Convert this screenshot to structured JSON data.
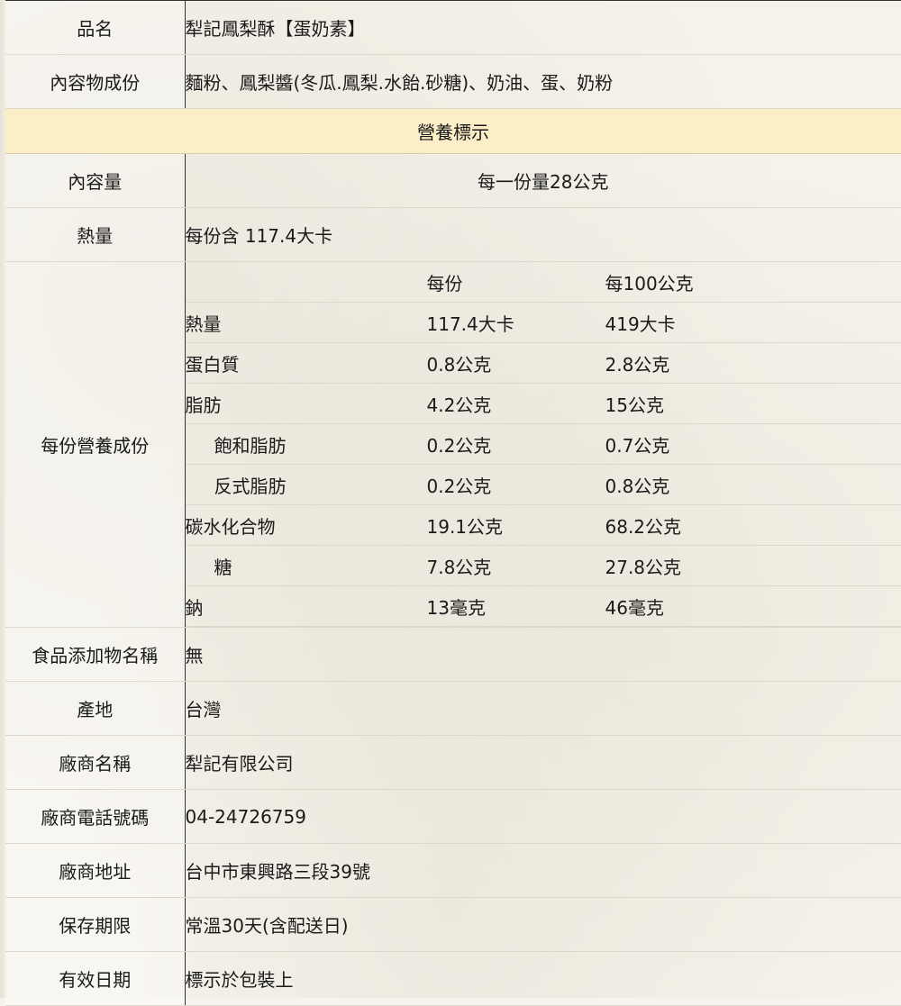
{
  "rows_top": [
    {
      "label": "品名",
      "value": "犁記鳳梨酥【蛋奶素】"
    },
    {
      "label": "內容物成份",
      "value": "麵粉、鳳梨醬(冬瓜.鳳梨.水飴.砂糖)、奶油、蛋、奶粉"
    }
  ],
  "banner": "營養標示",
  "serving": {
    "label": "內容量",
    "value": "每一份量28公克"
  },
  "calories": {
    "label": "熱量",
    "value": "每份含 117.4大卡"
  },
  "nutrition": {
    "label": "每份營養成份",
    "header": {
      "per_serving": "每份",
      "per_100g": "每100公克"
    },
    "items": [
      {
        "name": "熱量",
        "per_serving": "117.4大卡",
        "per_100g": "419大卡"
      },
      {
        "name": "蛋白質",
        "per_serving": "0.8公克",
        "per_100g": "2.8公克"
      },
      {
        "name": "脂肪",
        "per_serving": "4.2公克",
        "per_100g": "15公克"
      },
      {
        "name": "飽和脂肪",
        "per_serving": "0.2公克",
        "per_100g": "0.7公克"
      },
      {
        "name": "反式脂肪",
        "per_serving": "0.2公克",
        "per_100g": "0.8公克"
      },
      {
        "name": "碳水化合物",
        "per_serving": "19.1公克",
        "per_100g": "68.2公克"
      },
      {
        "name": "糖",
        "per_serving": "7.8公克",
        "per_100g": "27.8公克"
      },
      {
        "name": "鈉",
        "per_serving": "13毫克",
        "per_100g": "46毫克"
      }
    ]
  },
  "rows_bottom": [
    {
      "label": "食品添加物名稱",
      "value": "無"
    },
    {
      "label": "產地",
      "value": "台灣"
    },
    {
      "label": "廠商名稱",
      "value": "犁記有限公司"
    },
    {
      "label": "廠商電話號碼",
      "value": "04-24726759"
    },
    {
      "label": "廠商地址",
      "value": "台中市東興路三段39號"
    },
    {
      "label": "保存期限",
      "value": "常溫30天(含配送日)"
    },
    {
      "label": "有效日期",
      "value": "標示於包裝上"
    }
  ]
}
